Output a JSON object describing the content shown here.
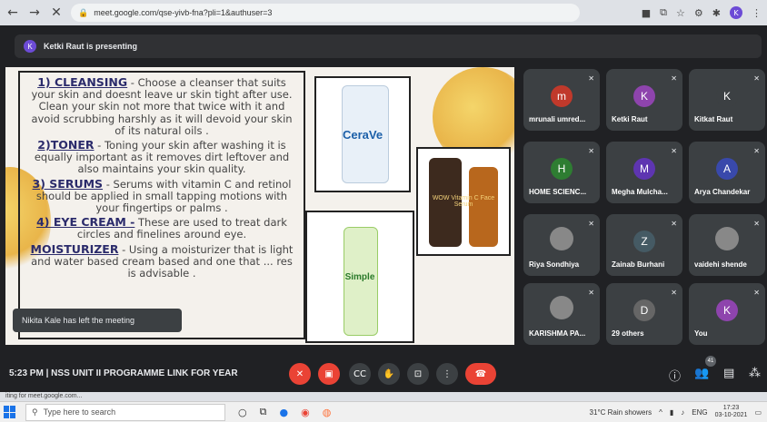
{
  "browser": {
    "url": "meet.google.com/qse-yivb-fna?pli=1&authuser=3",
    "profile_initial": "K"
  },
  "presenting": {
    "avatar_initial": "K",
    "text": "Ketki Raut is presenting"
  },
  "slide": {
    "p1_head": "1) CLEANSING",
    "p1_text": " - Choose a cleanser that suits your skin and doesnt leave ur skin tight after use. Clean your skin not more that twice with it and avoid scrubbing harshly as it will devoid your skin of its natural oils .",
    "p2_head": "2)TONER",
    "p2_text": " - Toning your skin after washing it is equally important as it removes dirt leftover and also maintains your skin quality.",
    "p3_head": "3) SERUMS",
    "p3_text": " - Serums with vitamin C and retinol should be applied in small tapping motions with your fingertips or palms .",
    "p4_head": "4) EYE CREAM -",
    "p4_text": " These are used to treat dark circles and finelines around eye.",
    "p5_head": "MOISTURIZER",
    "p5_text": " - Using a moisturizer that is light and water based cream based and one that ... res is advisable .",
    "product1_label": "CeraVe",
    "product2_label": "WOW Vitamin C Face Serum",
    "product3_label": "Simple"
  },
  "toast": "Nikita Kale has left the meeting",
  "participants": [
    {
      "name": "mrunali umred...",
      "initial": "m",
      "color": "#c0392b"
    },
    {
      "name": "Ketki Raut",
      "initial": "K",
      "color": "#8e44ad"
    },
    {
      "name": "Kitkat Raut",
      "initial": "K",
      "color": "#3c4043"
    },
    {
      "name": "HOME SCIENC...",
      "initial": "H",
      "color": "#2e7d32"
    },
    {
      "name": "Megha Mulcha...",
      "initial": "M",
      "color": "#5e35b1"
    },
    {
      "name": "Arya Chandekar",
      "initial": "A",
      "color": "#3949ab"
    },
    {
      "name": "Riya Sondhiya",
      "initial": "",
      "color": "#888"
    },
    {
      "name": "Zainab Burhani",
      "initial": "Z",
      "color": "#455a64"
    },
    {
      "name": "vaidehi shende",
      "initial": "",
      "color": "#888"
    },
    {
      "name": "KARISHMA PA...",
      "initial": "",
      "color": "#888"
    },
    {
      "name": "29 others",
      "initial": "D",
      "color": "#666"
    },
    {
      "name": "You",
      "initial": "K",
      "color": "#8e44ad"
    }
  ],
  "meeting": {
    "time": "5:23 PM",
    "separator": "|",
    "title": "NSS UNIT II PROGRAMME LINK FOR YEAR",
    "people_count": "41"
  },
  "status_text": "iting for meet.google.com...",
  "taskbar": {
    "search_placeholder": "Type here to search",
    "weather": "31°C  Rain showers",
    "lang": "ENG",
    "time": "17:23",
    "date": "03-10-2021"
  },
  "colors": {
    "accent_red": "#ea4335",
    "meet_bg": "#202124",
    "tile_bg": "#3c4043"
  }
}
